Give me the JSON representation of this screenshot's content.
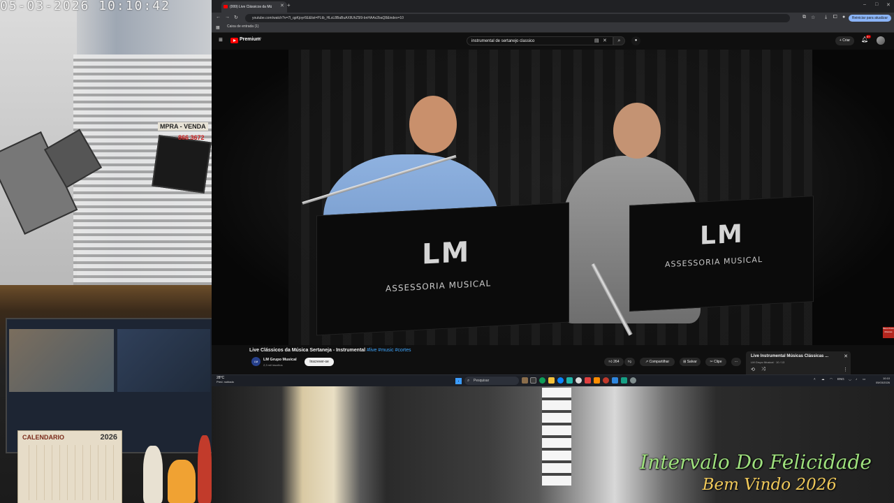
{
  "camera": {
    "timestamp": "05-03-2026  10:10:42",
    "sign_text": "MPRA - VENDA",
    "sign_phone": "866 3672",
    "calendar_label": "CALENDARIO",
    "calendar_year": "2026",
    "overlay_title": "Intervalo Do Felicidade",
    "overlay_subtitle": "Bem Vindo 2026"
  },
  "browser": {
    "tab_title": "(999) Live Clássicos da Mú",
    "url": "youtube.com/watch?v=7l_qpKjoyr6E&list=PLtb_HLsL8BaBuAXllUhZ5l9-bnHAAx2baQ8&index=10",
    "bookmark": "Caixa de entrada (1)",
    "update_button": "Reiniciar para atualizar"
  },
  "youtube": {
    "brand": "Premium",
    "country": "BR",
    "search_query": "instrumental de sertanejo classico",
    "create_label": "Criar",
    "notifications": "9+",
    "video": {
      "logo_mark": "LM",
      "logo_text": "ASSESSORIA MUSICAL",
      "badge": "Meus Posts Músicas"
    },
    "title": "Live Clássicos da Música Sertaneja - Instrumental",
    "title_tags": "#live #music #cortes",
    "channel_initials": "LM",
    "channel_name": "LM Grupo Musical",
    "channel_subs": "2,3 mil inscritos",
    "subscribe_label": "Inscrever-se",
    "likes": "264",
    "share_label": "Compartilhar",
    "save_label": "Salvar",
    "clip_label": "Clipe",
    "more_label": "···",
    "playlist_title": "Live Instrumental Músicas Clássicas ...",
    "playlist_sub": "LM Grupo Musical · 10 / 13"
  },
  "taskbar": {
    "temperature": "28°C",
    "weather_desc": "Pred. nublado",
    "search_placeholder": "Pesquisar",
    "lang": "ENG",
    "time": "10:10",
    "date": "05/03/2026"
  }
}
